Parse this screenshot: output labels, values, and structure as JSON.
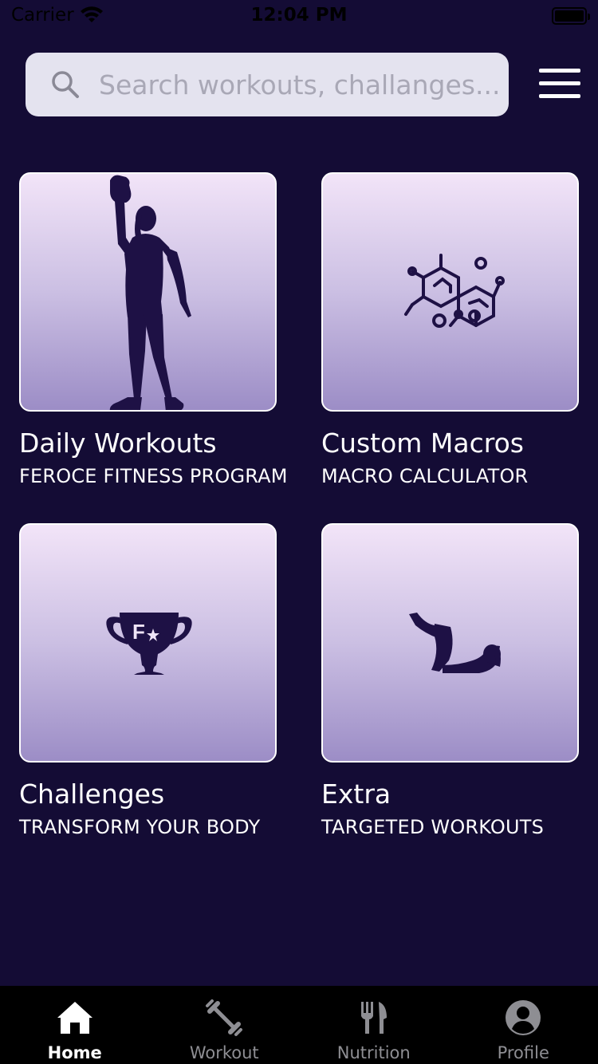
{
  "status_bar": {
    "carrier": "Carrier",
    "time": "12:04 PM"
  },
  "search": {
    "placeholder": "Search workouts, challanges..."
  },
  "cards": [
    {
      "title": "Daily Workouts",
      "subtitle": "FEROCE FITNESS PROGRAM",
      "icon": "woman-kettlebell-silhouette"
    },
    {
      "title": "Custom Macros",
      "subtitle": "MACRO CALCULATOR",
      "icon": "molecule-icon"
    },
    {
      "title": "Challenges",
      "subtitle": "TRANSFORM YOUR BODY",
      "icon": "trophy-icon"
    },
    {
      "title": "Extra",
      "subtitle": "TARGETED WORKOUTS",
      "icon": "crunch-exercise-silhouette"
    }
  ],
  "tabs": [
    {
      "label": "Home",
      "icon": "home-icon",
      "active": true
    },
    {
      "label": "Workout",
      "icon": "dumbbell-icon",
      "active": false
    },
    {
      "label": "Nutrition",
      "icon": "fork-knife-icon",
      "active": false
    },
    {
      "label": "Profile",
      "icon": "profile-icon",
      "active": false
    }
  ],
  "colors": {
    "background": "#140c35",
    "tile_top": "#f2e4f8",
    "tile_bottom": "#9c8dc6",
    "icon": "#1e1145",
    "tab_bar": "#000000"
  }
}
